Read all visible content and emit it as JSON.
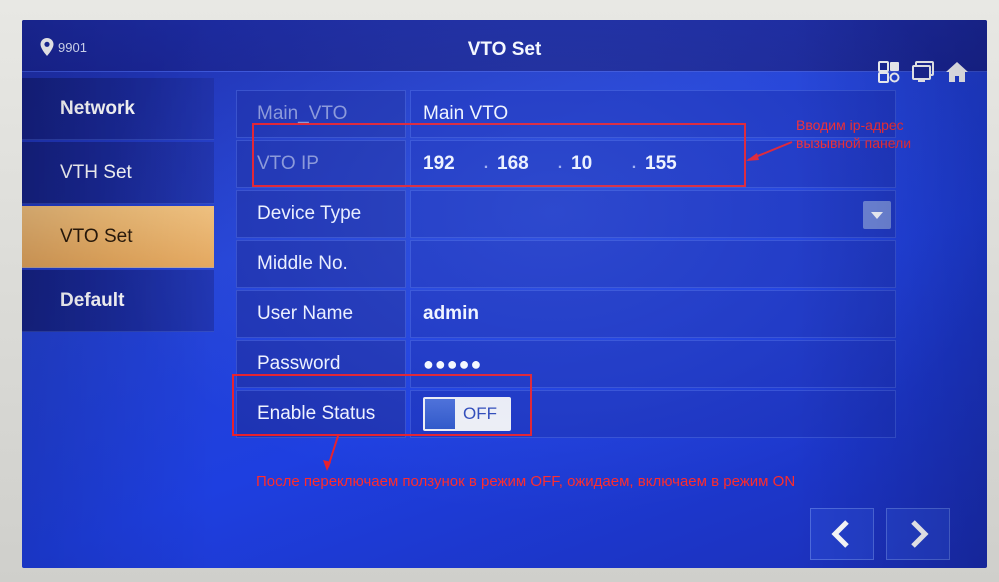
{
  "header": {
    "room_number": "9901",
    "title": "VTO Set"
  },
  "icons": {
    "location": "location-pin-icon",
    "network_settings": "network-settings-icon",
    "monitor": "monitor-icon",
    "home": "home-icon",
    "prev": "chevron-left-icon",
    "next": "chevron-right-icon"
  },
  "sidebar": {
    "items": [
      {
        "label": "Network"
      },
      {
        "label": "VTH Set"
      },
      {
        "label": "VTO Set"
      },
      {
        "label": "Default"
      }
    ],
    "active_index": 2
  },
  "form": {
    "main_vto_label": "Main_VTO",
    "main_vto_value": "Main VTO",
    "vto_ip_label": "VTO IP",
    "ip_octets": [
      "192",
      "168",
      "10",
      "155"
    ],
    "device_type_label": "Device Type",
    "device_type_value": "",
    "middle_no_label": "Middle No.",
    "middle_no_value": "",
    "user_name_label": "User Name",
    "user_name_value": "admin",
    "password_label": "Password",
    "password_value": "●●●●●",
    "enable_status_label": "Enable Status",
    "enable_status_value": "OFF"
  },
  "annotations": {
    "ip_note_line1": "Вводим ip-адрес",
    "ip_note_line2": "вызывной панели",
    "status_note": "После переключаем ползунок в режим OFF, ожидаем, включаем в режим ON",
    "color": "#e8202c"
  },
  "colors": {
    "screen_blue": "#2443d6",
    "active_tab": "#eeb066"
  }
}
